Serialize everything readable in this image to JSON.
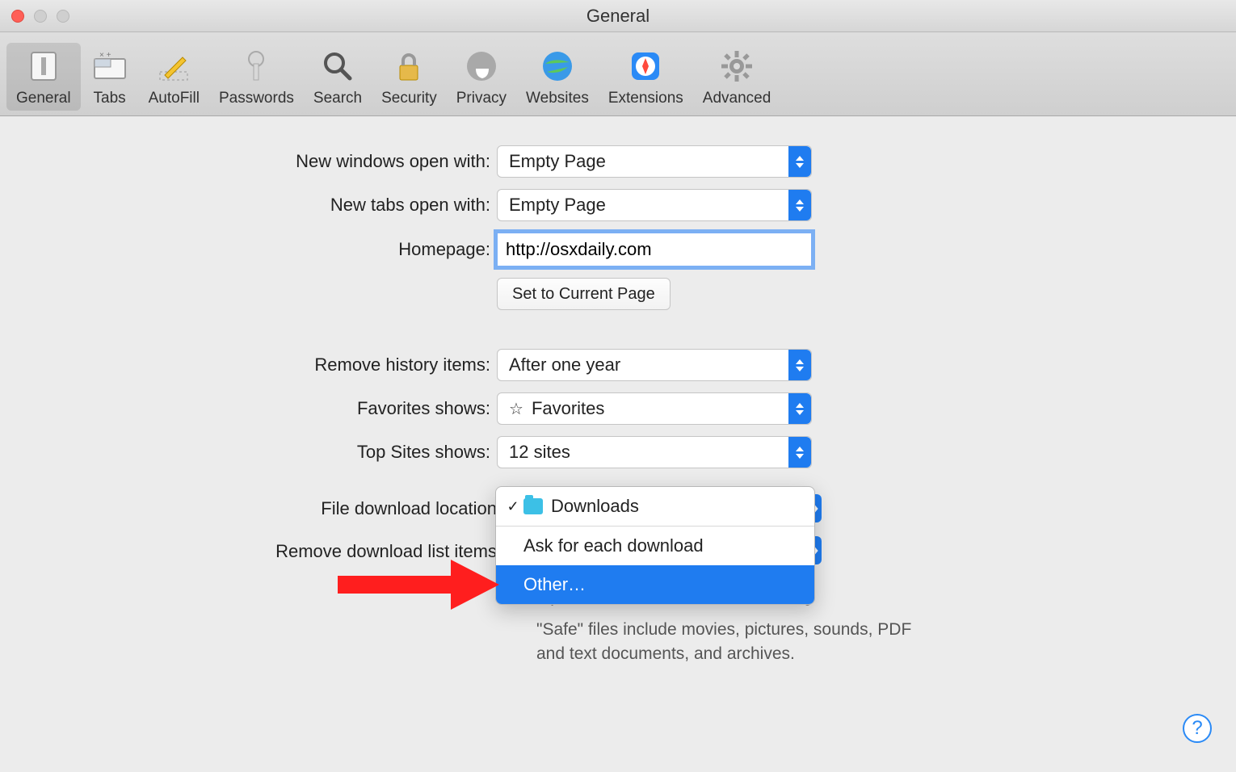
{
  "window": {
    "title": "General"
  },
  "toolbar": {
    "items": [
      {
        "label": "General",
        "selected": true
      },
      {
        "label": "Tabs"
      },
      {
        "label": "AutoFill"
      },
      {
        "label": "Passwords"
      },
      {
        "label": "Search"
      },
      {
        "label": "Security"
      },
      {
        "label": "Privacy"
      },
      {
        "label": "Websites"
      },
      {
        "label": "Extensions"
      },
      {
        "label": "Advanced"
      }
    ]
  },
  "prefs": {
    "new_windows_label": "New windows open with:",
    "new_windows_value": "Empty Page",
    "new_tabs_label": "New tabs open with:",
    "new_tabs_value": "Empty Page",
    "homepage_label": "Homepage:",
    "homepage_value": "http://osxdaily.com",
    "set_current_btn": "Set to Current Page",
    "remove_history_label": "Remove history items:",
    "remove_history_value": "After one year",
    "favorites_label": "Favorites shows:",
    "favorites_value": "Favorites",
    "topsites_label": "Top Sites shows:",
    "topsites_value": "12 sites",
    "file_dl_label": "File download location",
    "remove_dl_label": "Remove download list items",
    "open_safe_label": "Open \"safe\" files after downloading",
    "open_safe_desc": "\"Safe\" files include movies, pictures, sounds, PDF and text documents, and archives."
  },
  "download_popup": {
    "downloads": "Downloads",
    "ask": "Ask for each download",
    "other": "Other…"
  },
  "help_label": "?"
}
